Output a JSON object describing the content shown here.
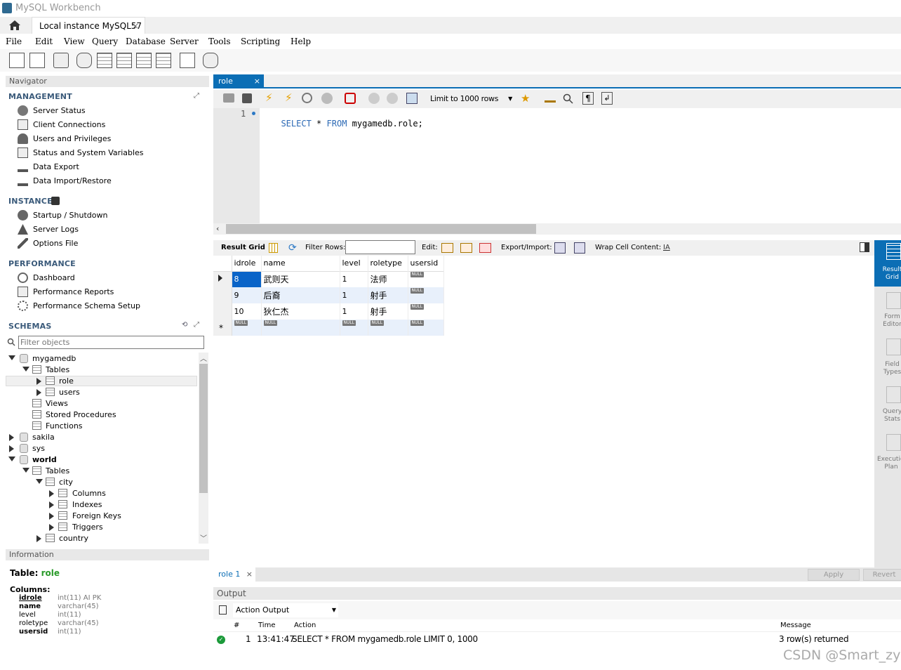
{
  "app": {
    "title": "MySQL Workbench",
    "tab": "Local instance MySQL57"
  },
  "menu": [
    "File",
    "Edit",
    "View",
    "Query",
    "Database",
    "Server",
    "Tools",
    "Scripting",
    "Help"
  ],
  "navigator": {
    "title": "Navigator",
    "management": {
      "title": "MANAGEMENT",
      "items": [
        "Server Status",
        "Client Connections",
        "Users and Privileges",
        "Status and System Variables",
        "Data Export",
        "Data Import/Restore"
      ]
    },
    "instance": {
      "title": "INSTANCE",
      "items": [
        "Startup / Shutdown",
        "Server Logs",
        "Options File"
      ]
    },
    "performance": {
      "title": "PERFORMANCE",
      "items": [
        "Dashboard",
        "Performance Reports",
        "Performance Schema Setup"
      ]
    },
    "schemas": {
      "title": "SCHEMAS",
      "filter_placeholder": "Filter objects"
    }
  },
  "tree": {
    "mygamedb": "mygamedb",
    "tables": "Tables",
    "role": "role",
    "users": "users",
    "views": "Views",
    "procs": "Stored Procedures",
    "funcs": "Functions",
    "sakila": "sakila",
    "sys": "sys",
    "world": "world",
    "world_tables": "Tables",
    "city": "city",
    "columns": "Columns",
    "indexes": "Indexes",
    "fks": "Foreign Keys",
    "triggers": "Triggers",
    "country": "country"
  },
  "info": {
    "header": "Information",
    "table_label": "Table:",
    "table_name": "role",
    "columns_label": "Columns:",
    "columns": [
      {
        "name": "idrole",
        "type": "int(11) AI PK"
      },
      {
        "name": "name",
        "type": "varchar(45)"
      },
      {
        "name": "level",
        "type": "int(11)"
      },
      {
        "name": "roletype",
        "type": "varchar(45)"
      },
      {
        "name": "usersid",
        "type": "int(11)"
      }
    ]
  },
  "editor": {
    "tab": "role",
    "limit": "Limit to 1000 rows",
    "line_no": "1",
    "sql": {
      "kw1": "SELECT",
      "star": "*",
      "kw2": "FROM",
      "target": "mygamedb.role;"
    }
  },
  "result": {
    "toolbar": {
      "result_grid": "Result Grid",
      "filter_rows": "Filter Rows:",
      "edit": "Edit:",
      "export": "Export/Import:",
      "wrap": "Wrap Cell Content:"
    },
    "columns": [
      "idrole",
      "name",
      "level",
      "roletype",
      "usersid"
    ],
    "rows": [
      [
        "8",
        "武则天",
        "1",
        "法师",
        "NULL"
      ],
      [
        "9",
        "后裔",
        "1",
        "射手",
        "NULL"
      ],
      [
        "10",
        "狄仁杰",
        "1",
        "射手",
        "NULL"
      ]
    ],
    "null_label": "NULL",
    "tab": "role 1",
    "apply": "Apply",
    "revert": "Revert"
  },
  "side_buttons": [
    {
      "line1": "Result",
      "line2": "Grid"
    },
    {
      "line1": "Form",
      "line2": "Editor"
    },
    {
      "line1": "Field",
      "line2": "Types"
    },
    {
      "line1": "Query",
      "line2": "Stats"
    },
    {
      "line1": "Execution",
      "line2": "Plan"
    }
  ],
  "output": {
    "header": "Output",
    "selector": "Action Output",
    "columns": {
      "num": "#",
      "time": "Time",
      "action": "Action",
      "message": "Message"
    },
    "rows": [
      {
        "num": "1",
        "time": "13:41:47",
        "action": "SELECT * FROM mygamedb.role LIMIT 0, 1000",
        "message": "3 row(s) returned"
      }
    ]
  },
  "watermark": "CSDN @Smart_zy",
  "colors": {
    "accent": "#0b6eb5",
    "selected_cell": "#0a64c8",
    "row_alt": "#e8f0fb",
    "keyword": "#2d6ab5"
  }
}
